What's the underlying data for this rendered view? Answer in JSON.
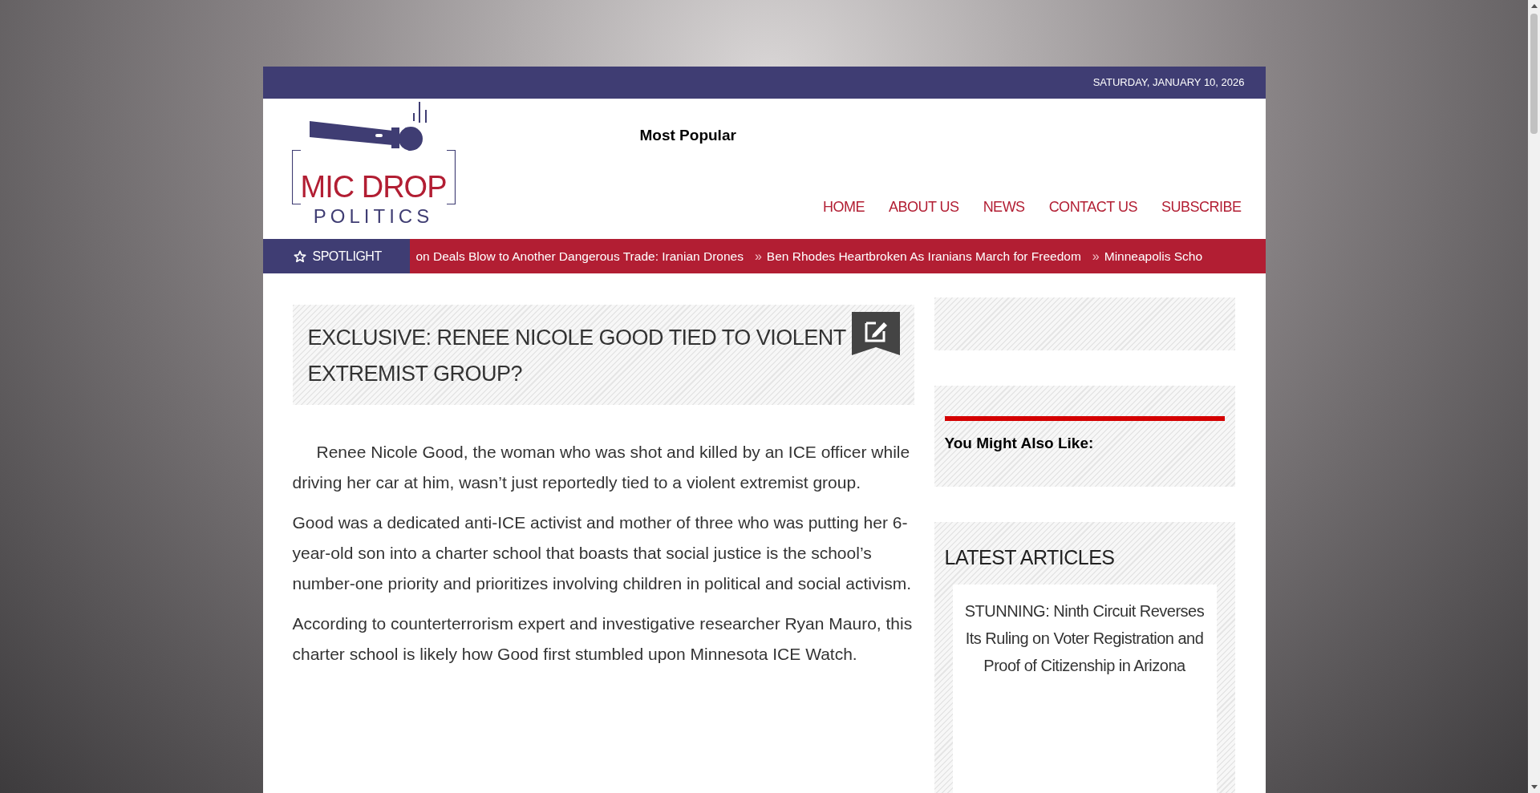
{
  "top_bar": {
    "date": "SATURDAY, JANUARY 10, 2026"
  },
  "logo": {
    "line_1": "MIC DROP",
    "line_2": "POLITICS"
  },
  "header": {
    "most_popular": "Most Popular"
  },
  "nav": [
    {
      "label": "HOME"
    },
    {
      "label": "ABOUT US"
    },
    {
      "label": "NEWS"
    },
    {
      "label": "CONTACT US"
    },
    {
      "label": "SUBSCRIBE"
    }
  ],
  "spotlight": {
    "label": "SPOTLIGHT",
    "items": [
      {
        "text": "on Deals Blow to Another Dangerous Trade: Iranian Drones"
      },
      {
        "marker": "»",
        "text": "Ben Rhodes Heartbroken As Iranians March for Freedom"
      },
      {
        "marker": "»",
        "text": "Minneapolis Scho"
      }
    ]
  },
  "article": {
    "title": "EXCLUSIVE: RENEE NICOLE GOOD TIED TO VIOLENT EXTREMIST GROUP?",
    "paragraphs": [
      {
        "kind": "indented",
        "text": "Renee Nicole Good, the woman who was shot and killed by an ICE officer while driving her car at him, wasn’t just reportedly tied to a violent extremist group."
      },
      {
        "kind": "plain",
        "text": "Good was a dedicated anti-ICE activist and mother of three who was putting her 6-year-old son into a charter school that boasts that social justice is the school’s number-one priority and prioritizes involving children in political and social activism."
      },
      {
        "kind": "plain",
        "text": "According to counterterrorism expert and investigative researcher Ryan Mauro, this charter school is likely how Good first stumbled upon Minnesota ICE Watch."
      }
    ]
  },
  "sidebar": [
    {
      "kind": "empty"
    },
    {
      "kind": "related",
      "heading": "You Might Also Like:"
    },
    {
      "kind": "latest",
      "heading": "LATEST ARTICLES",
      "articles": [
        {
          "title": "STUNNING: Ninth Circuit Reverses Its Ruling on Voter Registration and Proof of Citizenship in Arizona"
        }
      ]
    }
  ]
}
